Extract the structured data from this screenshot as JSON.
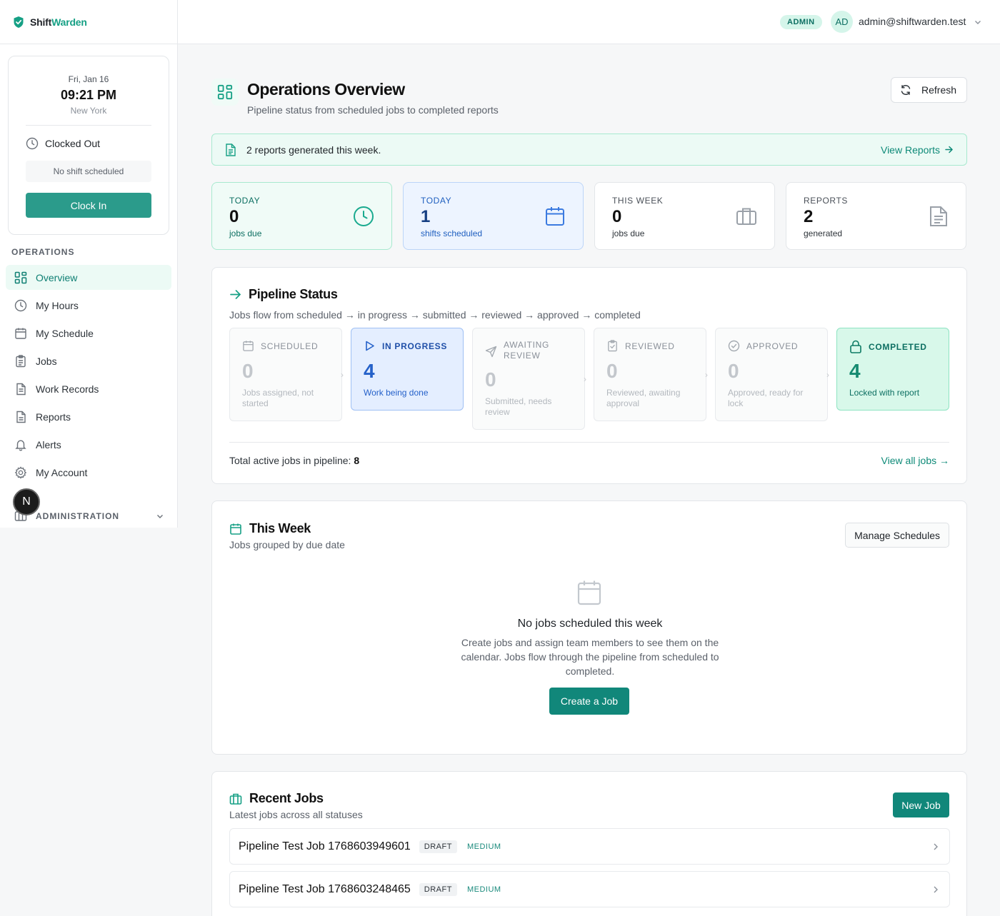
{
  "brand": {
    "part1": "Shift",
    "part2": "Warden"
  },
  "clock": {
    "date": "Fri, Jan 16",
    "time": "09:21 PM",
    "city": "New York",
    "status": "Clocked Out",
    "shift_note": "No shift scheduled",
    "button": "Clock In"
  },
  "sidebar": {
    "operations_label": "OPERATIONS",
    "items": [
      {
        "label": "Overview",
        "icon": "grid-icon"
      },
      {
        "label": "My Hours",
        "icon": "clock-icon"
      },
      {
        "label": "My Schedule",
        "icon": "calendar-icon"
      },
      {
        "label": "Jobs",
        "icon": "clipboard-icon"
      },
      {
        "label": "Work Records",
        "icon": "document-icon"
      },
      {
        "label": "Reports",
        "icon": "file-icon"
      },
      {
        "label": "Alerts",
        "icon": "bell-icon"
      },
      {
        "label": "My Account",
        "icon": "gear-icon"
      }
    ],
    "admin_label": "ADMINISTRATION",
    "n_badge": "N"
  },
  "topbar": {
    "role": "ADMIN",
    "avatar": "AD",
    "email": "admin@shiftwarden.test"
  },
  "page": {
    "title": "Operations Overview",
    "subtitle": "Pipeline status from scheduled jobs to completed reports",
    "refresh": "Refresh"
  },
  "banner": {
    "text": "2 reports generated this week.",
    "link": "View Reports"
  },
  "stats": [
    {
      "label": "TODAY",
      "value": "0",
      "desc": "jobs due"
    },
    {
      "label": "TODAY",
      "value": "1",
      "desc": "shifts scheduled"
    },
    {
      "label": "THIS WEEK",
      "value": "0",
      "desc": "jobs due"
    },
    {
      "label": "REPORTS",
      "value": "2",
      "desc": "generated"
    }
  ],
  "pipeline": {
    "title": "Pipeline Status",
    "subtitle": "Jobs flow from scheduled → in progress → submitted → reviewed → approved → completed",
    "stages": [
      {
        "label": "SCHEDULED",
        "count": "0",
        "desc": "Jobs assigned, not started"
      },
      {
        "label": "IN PROGRESS",
        "count": "4",
        "desc": "Work being done"
      },
      {
        "label": "AWAITING REVIEW",
        "count": "0",
        "desc": "Submitted, needs review"
      },
      {
        "label": "REVIEWED",
        "count": "0",
        "desc": "Reviewed, awaiting approval"
      },
      {
        "label": "APPROVED",
        "count": "0",
        "desc": "Approved, ready for lock"
      },
      {
        "label": "COMPLETED",
        "count": "4",
        "desc": "Locked with report"
      }
    ],
    "total_label": "Total active jobs in pipeline:",
    "total_value": "8",
    "link": "View all jobs →"
  },
  "week": {
    "title": "This Week",
    "subtitle": "Jobs grouped by due date",
    "manage": "Manage Schedules",
    "empty_title": "No jobs scheduled this week",
    "empty_text": "Create jobs and assign team members to see them on the calendar. Jobs flow through the pipeline from scheduled to completed.",
    "create": "Create a Job"
  },
  "recent": {
    "title": "Recent Jobs",
    "subtitle": "Latest jobs across all statuses",
    "new": "New Job",
    "jobs": [
      {
        "name": "Pipeline Test Job 1768603949601",
        "status": "DRAFT",
        "priority": "MEDIUM"
      },
      {
        "name": "Pipeline Test Job 1768603248465",
        "status": "DRAFT",
        "priority": "MEDIUM"
      }
    ]
  },
  "colors": {
    "accent": "#11877a",
    "accent_light": "#ecfaf5",
    "blue": "#2561c9"
  }
}
